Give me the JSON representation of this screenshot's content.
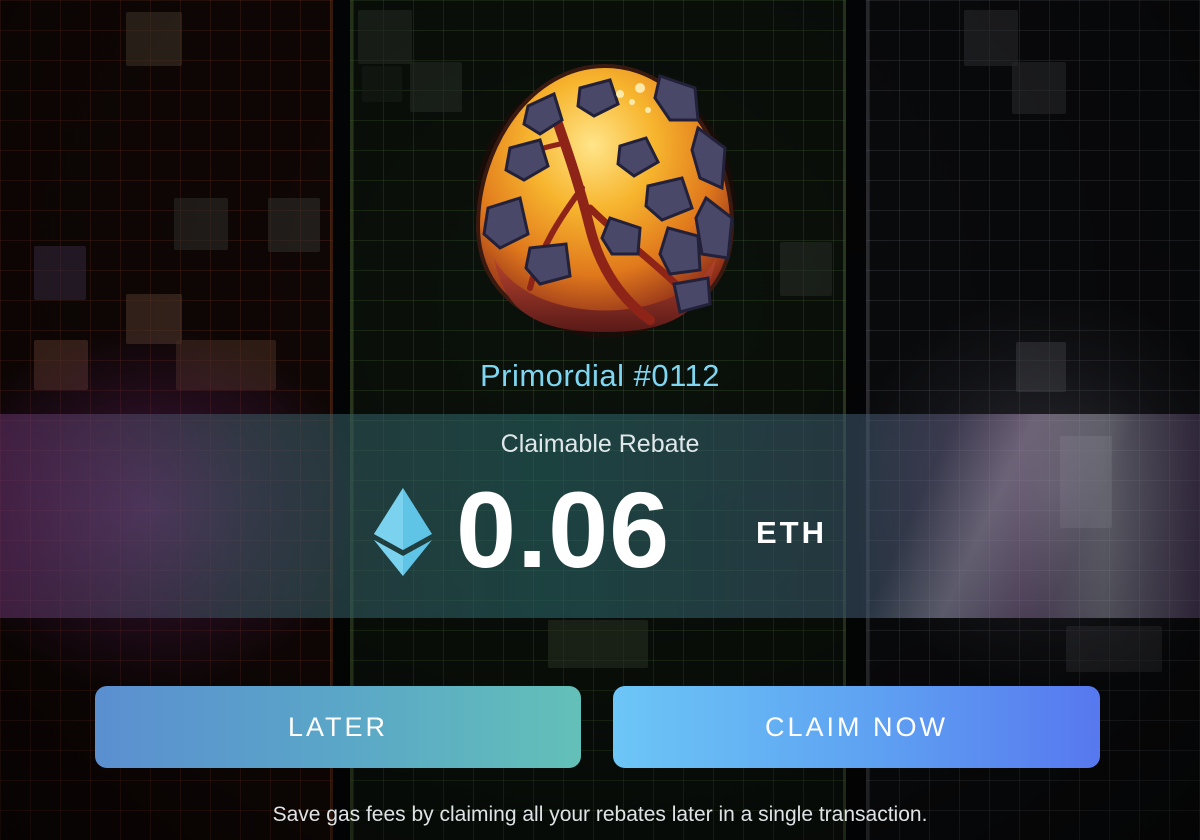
{
  "nft": {
    "name": "Primordial #0112",
    "icon": "egg-icon"
  },
  "rebate": {
    "label": "Claimable Rebate",
    "amount": "0.06",
    "unit": "ETH",
    "currency_icon": "ethereum-icon"
  },
  "actions": {
    "later_label": "LATER",
    "claim_label": "CLAIM NOW"
  },
  "footnote": "Save gas fees by claiming all your rebates later in a single transaction.",
  "colors": {
    "name_text": "#7fd6f0",
    "eth_icon": "#5fc4e6",
    "later_gradient_start": "#5b8fd0",
    "later_gradient_end": "#63c0b8",
    "claim_gradient_start": "#6cc6f6",
    "claim_gradient_end": "#5778ef"
  }
}
